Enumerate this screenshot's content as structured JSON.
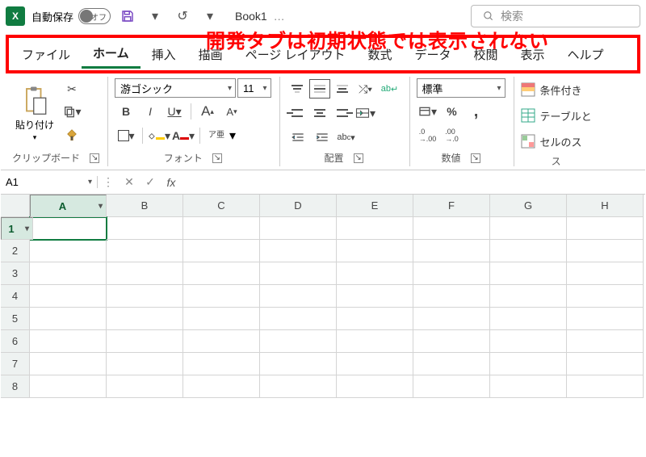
{
  "titlebar": {
    "autosave_label": "自動保存",
    "autosave_state": "オフ",
    "book_name": "Book1",
    "book_suffix": "…",
    "search_placeholder": "検索"
  },
  "annotation": "開発タブは初期状態では表示されない",
  "tabs": {
    "file": "ファイル",
    "home": "ホーム",
    "insert": "挿入",
    "draw": "描画",
    "pagelayout": "ページ レイアウト",
    "formulas": "数式",
    "data": "データ",
    "review": "校閲",
    "view": "表示",
    "help": "ヘルプ"
  },
  "ribbon": {
    "clipboard": {
      "paste": "貼り付け",
      "label": "クリップボード"
    },
    "font": {
      "name": "游ゴシック",
      "size": "11",
      "bold": "B",
      "italic": "I",
      "underline": "U",
      "grow": "A",
      "shrink": "A",
      "fill": "A",
      "fontcolor": "A",
      "phonetic": "ア亜",
      "label": "フォント"
    },
    "alignment": {
      "wrap": "ab",
      "merge": "",
      "label": "配置"
    },
    "number": {
      "format": "標準",
      "percent": "%",
      "comma": "ﾂ",
      "incdec_up": ".0 .00",
      "incdec_dn": ".00 .0",
      "label": "数値"
    },
    "styles": {
      "cond": "条件付き",
      "table": "テーブルと",
      "cell": "セルのス",
      "label": "ス"
    }
  },
  "formulaBar": {
    "nameBox": "A1",
    "fx": "fx",
    "value": ""
  },
  "grid": {
    "cols": [
      "A",
      "B",
      "C",
      "D",
      "E",
      "F",
      "G",
      "H"
    ],
    "rows": [
      "1",
      "2",
      "3",
      "4",
      "5",
      "6",
      "7",
      "8"
    ]
  }
}
